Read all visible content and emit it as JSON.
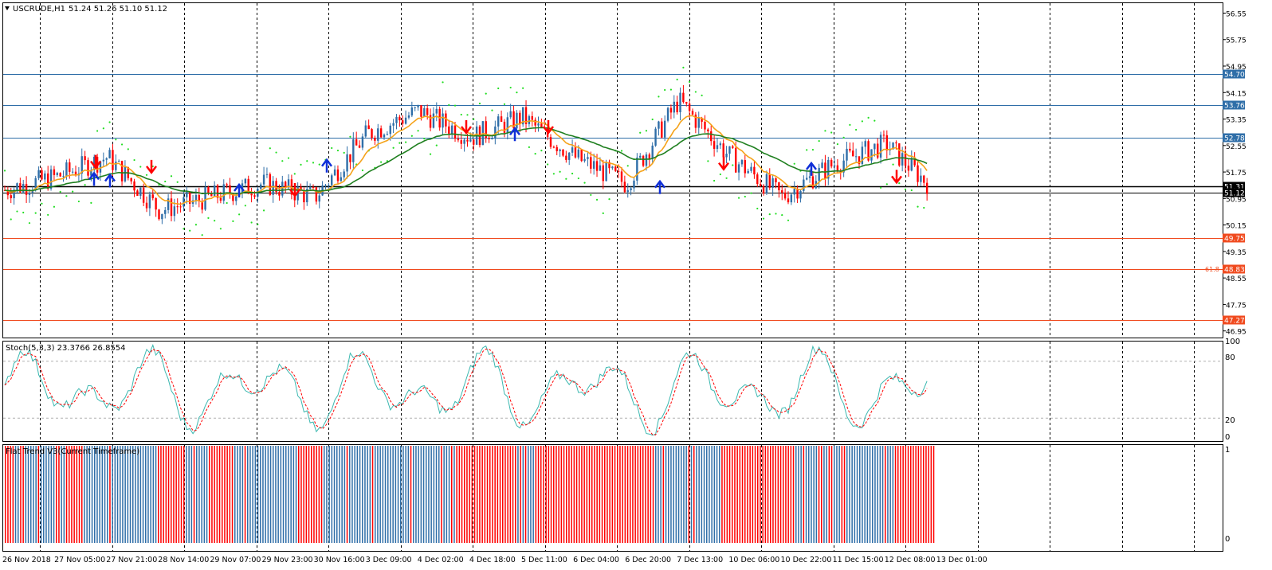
{
  "header": {
    "symbol": "USCRUDE,H1",
    "ohlc": "51.24 51.26 51.10 51.12"
  },
  "stoch_panel": {
    "label": "Stoch(5,3,3) 23.3766 26.8554",
    "scale": [
      "100",
      "80",
      "20",
      "0"
    ]
  },
  "flat_panel": {
    "label": "Flat Trend V3(Current Timeframe)",
    "scale": [
      "1",
      "0"
    ]
  },
  "price_axis": {
    "ticks": [
      "56.55",
      "55.75",
      "54.95",
      "54.15",
      "53.35",
      "52.55",
      "51.75",
      "50.95",
      "50.15",
      "49.35",
      "48.55",
      "47.75",
      "46.95"
    ],
    "level_boxes": [
      {
        "label": "54.70",
        "value": 54.7,
        "color": "#2f6ea8"
      },
      {
        "label": "53.76",
        "value": 53.76,
        "color": "#2f6ea8"
      },
      {
        "label": "52.78",
        "value": 52.78,
        "color": "#2f6ea8"
      },
      {
        "label": "51.31",
        "value": 51.31,
        "color": "#000000"
      },
      {
        "label": "51.12",
        "value": 51.12,
        "color": "#000000"
      },
      {
        "label": "49.75",
        "value": 49.75,
        "color": "#f04a1e"
      },
      {
        "label": "48.83",
        "value": 48.83,
        "color": "#f04a1e"
      },
      {
        "label": "47.27",
        "value": 47.27,
        "color": "#f04a1e"
      }
    ],
    "fib_note": "61.8"
  },
  "time_axis": [
    "26 Nov 2018",
    "27 Nov 05:00",
    "27 Nov 21:00",
    "28 Nov 14:00",
    "29 Nov 07:00",
    "29 Nov 23:00",
    "30 Nov 16:00",
    "3 Dec 09:00",
    "4 Dec 02:00",
    "4 Dec 18:00",
    "5 Dec 11:00",
    "6 Dec 04:00",
    "6 Dec 20:00",
    "7 Dec 13:00",
    "10 Dec 06:00",
    "10 Dec 22:00",
    "11 Dec 15:00",
    "12 Dec 08:00",
    "13 Dec 01:00"
  ],
  "colors": {
    "bull": "#2f6ea8",
    "bear": "#ff0000",
    "ma_fast": "#f5a31a",
    "ma_slow": "#208020",
    "psar": "#22dd22",
    "stoch_main": "#3bb8b0",
    "stoch_signal": "#ff0000",
    "grid": "#000000"
  },
  "chart_data": {
    "type": "candlestick",
    "timeframe": "H1",
    "ylim": [
      46.75,
      56.85
    ],
    "key_points": [
      {
        "t": "26 Nov 2018",
        "price": 51.2
      },
      {
        "t": "27 Nov 05:00",
        "price": 51.6
      },
      {
        "t": "27 Nov 21:00",
        "price": 52.2
      },
      {
        "t": "28 Nov 14:00",
        "price": 50.6
      },
      {
        "t": "29 Nov 07:00",
        "price": 51.0
      },
      {
        "t": "29 Nov 23:00",
        "price": 51.4
      },
      {
        "t": "30 Nov 16:00",
        "price": 51.0
      },
      {
        "t": "3 Dec 09:00",
        "price": 52.9
      },
      {
        "t": "4 Dec 02:00",
        "price": 53.6
      },
      {
        "t": "4 Dec 18:00",
        "price": 52.8
      },
      {
        "t": "5 Dec 11:00",
        "price": 53.4
      },
      {
        "t": "6 Dec 04:00",
        "price": 52.2
      },
      {
        "t": "6 Dec 20:00",
        "price": 51.4
      },
      {
        "t": "7 Dec 13:00",
        "price": 53.9
      },
      {
        "t": "10 Dec 06:00",
        "price": 52.2
      },
      {
        "t": "10 Dec 22:00",
        "price": 51.0
      },
      {
        "t": "11 Dec 15:00",
        "price": 52.0
      },
      {
        "t": "12 Dec 08:00",
        "price": 52.6
      },
      {
        "t": "13 Dec 01:00",
        "price": 51.12
      }
    ]
  }
}
